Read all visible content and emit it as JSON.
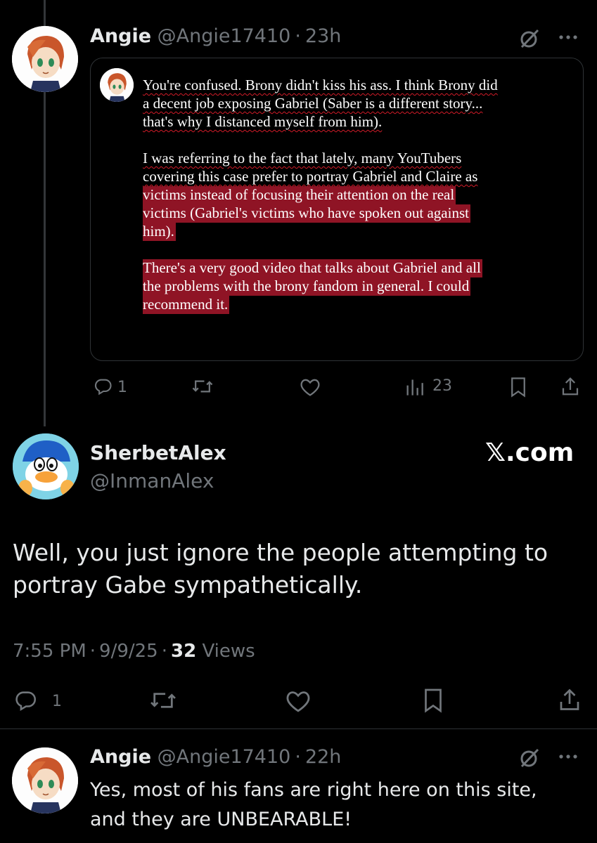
{
  "tweet1": {
    "display_name": "Angie",
    "handle": "@Angie17410",
    "sep": "·",
    "time": "23h",
    "quote": {
      "lines": [
        {
          "text": "You're confused. Brony didn't kiss his ass. I think Brony did",
          "hl": false
        },
        {
          "text": "a decent job exposing Gabriel (Saber is a different story...",
          "hl": false
        },
        {
          "text": "that's why I distanced myself from him).",
          "hl": false
        },
        {
          "text": "",
          "hl": false
        },
        {
          "text": "I was referring to the fact that lately, many YouTubers",
          "hl": false
        },
        {
          "text": "covering this case prefer to portray Gabriel and Claire as",
          "hl": false
        },
        {
          "text": "victims instead of focusing their attention on the real",
          "hl": true
        },
        {
          "text": "victims (Gabriel's victims who have spoken out against",
          "hl": true
        },
        {
          "text": "him).",
          "hl": true
        },
        {
          "text": "",
          "hl": false
        },
        {
          "text": "There's a very good video that talks about Gabriel and all",
          "hl": true
        },
        {
          "text": "the problems with the brony fandom in general. I could",
          "hl": true
        },
        {
          "text": "recommend it.",
          "hl": true
        }
      ]
    },
    "actions": {
      "replies": "1",
      "views": "23"
    }
  },
  "tweet2": {
    "display_name": "SherbetAlex",
    "handle": "@InmanAlex",
    "watermark": "𝕏.com",
    "body_lines": [
      "Well, you just ignore the people attempting to",
      "portray Gabe sympathetically."
    ],
    "time": "7:55 PM",
    "date": "9/9/25",
    "sep": "·",
    "views_count": "32",
    "views_label": "Views",
    "actions": {
      "replies": "1"
    }
  },
  "tweet3": {
    "display_name": "Angie",
    "handle": "@Angie17410",
    "sep": "·",
    "time": "22h",
    "body_lines": [
      "Yes, most of his fans are right here on this site,",
      "and they are UNBEARABLE!"
    ]
  },
  "colors": {
    "background": "#000000",
    "text": "#e7e9ea",
    "muted": "#71767b",
    "highlight": "#8f1425",
    "border": "#2f3336"
  },
  "icons": [
    "more-icon",
    "grok-icon",
    "reply-icon",
    "retweet-icon",
    "like-icon",
    "views-icon",
    "bookmark-icon",
    "share-icon"
  ]
}
